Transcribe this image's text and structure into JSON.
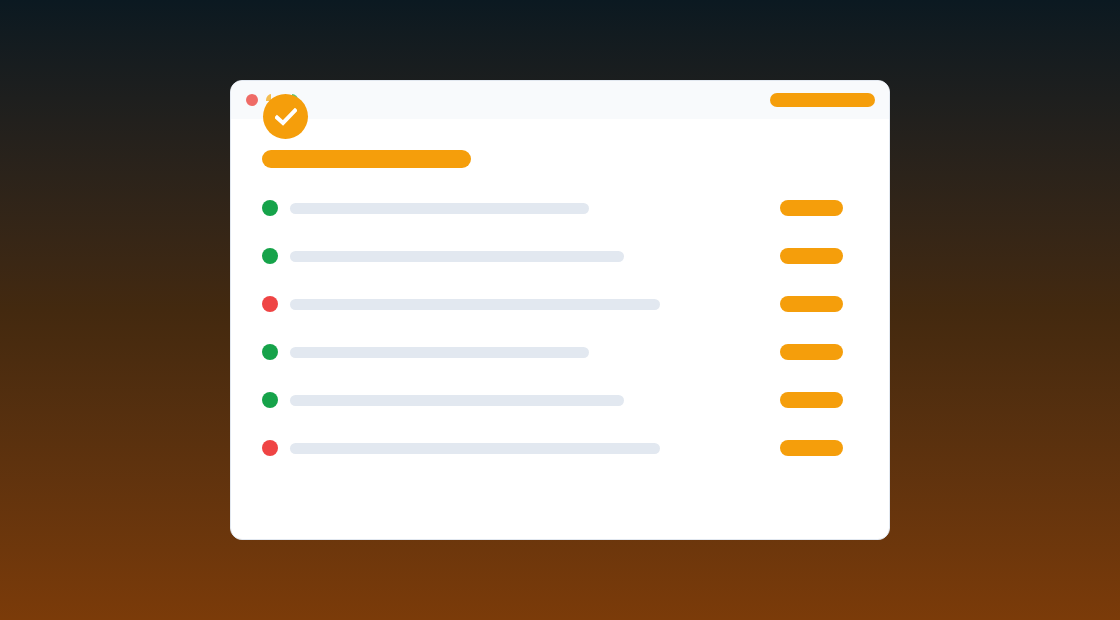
{
  "list": {
    "rows": [
      {
        "color": "#16a34a"
      },
      {
        "color": "#16a34a"
      },
      {
        "color": "#ef4444"
      },
      {
        "color": "#16a34a"
      },
      {
        "color": "#16a34a"
      },
      {
        "color": "#ef4444"
      }
    ]
  }
}
